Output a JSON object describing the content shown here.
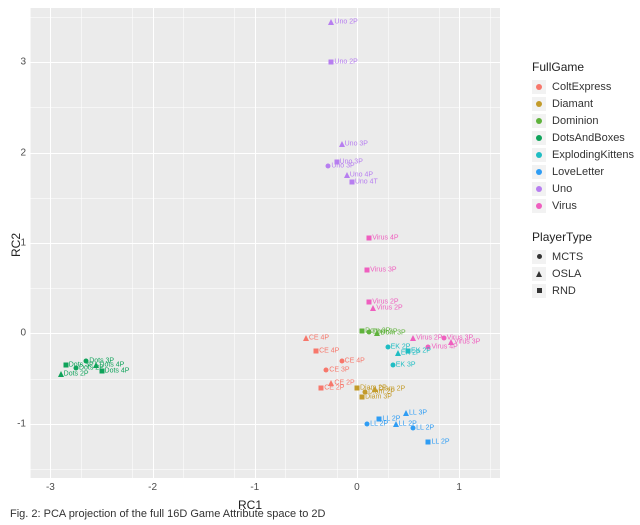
{
  "chart_data": {
    "type": "scatter",
    "title": "",
    "xlabel": "RC1",
    "ylabel": "RC2",
    "xlim": [
      -3.2,
      1.4
    ],
    "ylim": [
      -1.6,
      3.6
    ],
    "xticks": [
      -3,
      -2,
      -1,
      0,
      1
    ],
    "yticks": [
      -1,
      0,
      1,
      2,
      3
    ],
    "colors": {
      "ColtExpress": "#f7776b",
      "Diamant": "#c39b2a",
      "Dominion": "#5fb23c",
      "DotsAndBoxes": "#0fa35a",
      "ExplodingKittens": "#1fbdc3",
      "LoveLetter": "#2f9df4",
      "Uno": "#b77ef0",
      "Virus": "#ef5fbf"
    },
    "legend_fullgame_title": "FullGame",
    "legend_playertype_title": "PlayerType",
    "games": [
      "ColtExpress",
      "Diamant",
      "Dominion",
      "DotsAndBoxes",
      "ExplodingKittens",
      "LoveLetter",
      "Uno",
      "Virus"
    ],
    "player_types": [
      {
        "name": "MCTS",
        "shape": "circ"
      },
      {
        "name": "OSLA",
        "shape": "tri"
      },
      {
        "name": "RND",
        "shape": "sq"
      }
    ],
    "points": [
      {
        "x": -0.25,
        "y": 3.45,
        "g": "Uno",
        "s": "tri",
        "label": "Uno 2P"
      },
      {
        "x": -0.25,
        "y": 3.0,
        "g": "Uno",
        "s": "sq",
        "label": "Uno 2P"
      },
      {
        "x": -0.15,
        "y": 2.1,
        "g": "Uno",
        "s": "tri",
        "label": "Uno 3P"
      },
      {
        "x": -0.2,
        "y": 1.9,
        "g": "Uno",
        "s": "sq",
        "label": "Uno 3P"
      },
      {
        "x": -0.28,
        "y": 1.85,
        "g": "Uno",
        "s": "circ",
        "label": "Uno 3P"
      },
      {
        "x": -0.1,
        "y": 1.75,
        "g": "Uno",
        "s": "tri",
        "label": "Uno 4P"
      },
      {
        "x": -0.05,
        "y": 1.68,
        "g": "Uno",
        "s": "sq",
        "label": "Uno 4T"
      },
      {
        "x": 0.12,
        "y": 1.05,
        "g": "Virus",
        "s": "sq",
        "label": "Virus 4P"
      },
      {
        "x": 0.1,
        "y": 0.7,
        "g": "Virus",
        "s": "sq",
        "label": "Virus 3P"
      },
      {
        "x": 0.12,
        "y": 0.35,
        "g": "Virus",
        "s": "sq",
        "label": "Virus 2P"
      },
      {
        "x": 0.16,
        "y": 0.28,
        "g": "Virus",
        "s": "tri",
        "label": "Virus 2P"
      },
      {
        "x": 0.85,
        "y": -0.05,
        "g": "Virus",
        "s": "circ",
        "label": "Virus 3P"
      },
      {
        "x": 0.92,
        "y": -0.1,
        "g": "Virus",
        "s": "tri",
        "label": "Virus 3P"
      },
      {
        "x": 0.7,
        "y": -0.15,
        "g": "Virus",
        "s": "circ",
        "label": "Virus 4P"
      },
      {
        "x": 0.55,
        "y": -0.05,
        "g": "Virus",
        "s": "tri",
        "label": "Virus 2P"
      },
      {
        "x": 0.05,
        "y": 0.03,
        "g": "Dominion",
        "s": "sq",
        "label": "Dom 3P"
      },
      {
        "x": 0.12,
        "y": 0.02,
        "g": "Dominion",
        "s": "circ",
        "label": "Dom 3P"
      },
      {
        "x": 0.2,
        "y": 0.0,
        "g": "Dominion",
        "s": "tri",
        "label": "Dom 3P"
      },
      {
        "x": -0.4,
        "y": -0.2,
        "g": "ColtExpress",
        "s": "sq",
        "label": "CE 4P"
      },
      {
        "x": -0.3,
        "y": -0.4,
        "g": "ColtExpress",
        "s": "circ",
        "label": "CE 3P"
      },
      {
        "x": -0.35,
        "y": -0.6,
        "g": "ColtExpress",
        "s": "sq",
        "label": "CE 2P"
      },
      {
        "x": -0.25,
        "y": -0.55,
        "g": "ColtExpress",
        "s": "tri",
        "label": "CE 2P"
      },
      {
        "x": -0.15,
        "y": -0.3,
        "g": "ColtExpress",
        "s": "circ",
        "label": "CE 4P"
      },
      {
        "x": -0.5,
        "y": -0.05,
        "g": "ColtExpress",
        "s": "tri",
        "label": "CE 4P"
      },
      {
        "x": 0.0,
        "y": -0.6,
        "g": "Diamant",
        "s": "sq",
        "label": "Diam 2P"
      },
      {
        "x": 0.08,
        "y": -0.65,
        "g": "Diamant",
        "s": "circ",
        "label": "Diam 2P"
      },
      {
        "x": 0.18,
        "y": -0.62,
        "g": "Diamant",
        "s": "tri",
        "label": "Diam 2P"
      },
      {
        "x": 0.05,
        "y": -0.7,
        "g": "Diamant",
        "s": "sq",
        "label": "Diam 3P"
      },
      {
        "x": 0.3,
        "y": -0.15,
        "g": "ExplodingKittens",
        "s": "circ",
        "label": "EK 2P"
      },
      {
        "x": 0.4,
        "y": -0.22,
        "g": "ExplodingKittens",
        "s": "tri",
        "label": "EK 2P"
      },
      {
        "x": 0.5,
        "y": -0.2,
        "g": "ExplodingKittens",
        "s": "sq",
        "label": "EK 2P"
      },
      {
        "x": 0.35,
        "y": -0.35,
        "g": "ExplodingKittens",
        "s": "circ",
        "label": "EK 3P"
      },
      {
        "x": 0.1,
        "y": -1.0,
        "g": "LoveLetter",
        "s": "circ",
        "label": "LL 2P"
      },
      {
        "x": 0.22,
        "y": -0.95,
        "g": "LoveLetter",
        "s": "sq",
        "label": "LL 2P"
      },
      {
        "x": 0.38,
        "y": -1.0,
        "g": "LoveLetter",
        "s": "tri",
        "label": "LL 2P"
      },
      {
        "x": 0.55,
        "y": -1.05,
        "g": "LoveLetter",
        "s": "circ",
        "label": "LL 2P"
      },
      {
        "x": 0.7,
        "y": -1.2,
        "g": "LoveLetter",
        "s": "sq",
        "label": "LL 2P"
      },
      {
        "x": 0.48,
        "y": -0.88,
        "g": "LoveLetter",
        "s": "tri",
        "label": "LL 3P"
      },
      {
        "x": -2.85,
        "y": -0.35,
        "g": "DotsAndBoxes",
        "s": "sq",
        "label": "Dots 3P"
      },
      {
        "x": -2.9,
        "y": -0.45,
        "g": "DotsAndBoxes",
        "s": "tri",
        "label": "Dots 2P"
      },
      {
        "x": -2.75,
        "y": -0.38,
        "g": "DotsAndBoxes",
        "s": "circ",
        "label": "Dots 2P"
      },
      {
        "x": -2.65,
        "y": -0.3,
        "g": "DotsAndBoxes",
        "s": "circ",
        "label": "Dots 3P"
      },
      {
        "x": -2.55,
        "y": -0.35,
        "g": "DotsAndBoxes",
        "s": "tri",
        "label": "Dots 4P"
      },
      {
        "x": -2.5,
        "y": -0.42,
        "g": "DotsAndBoxes",
        "s": "sq",
        "label": "Dots 4P"
      }
    ]
  },
  "caption": "Fig. 2: PCA projection of the full 16D Game Attribute space to 2D"
}
